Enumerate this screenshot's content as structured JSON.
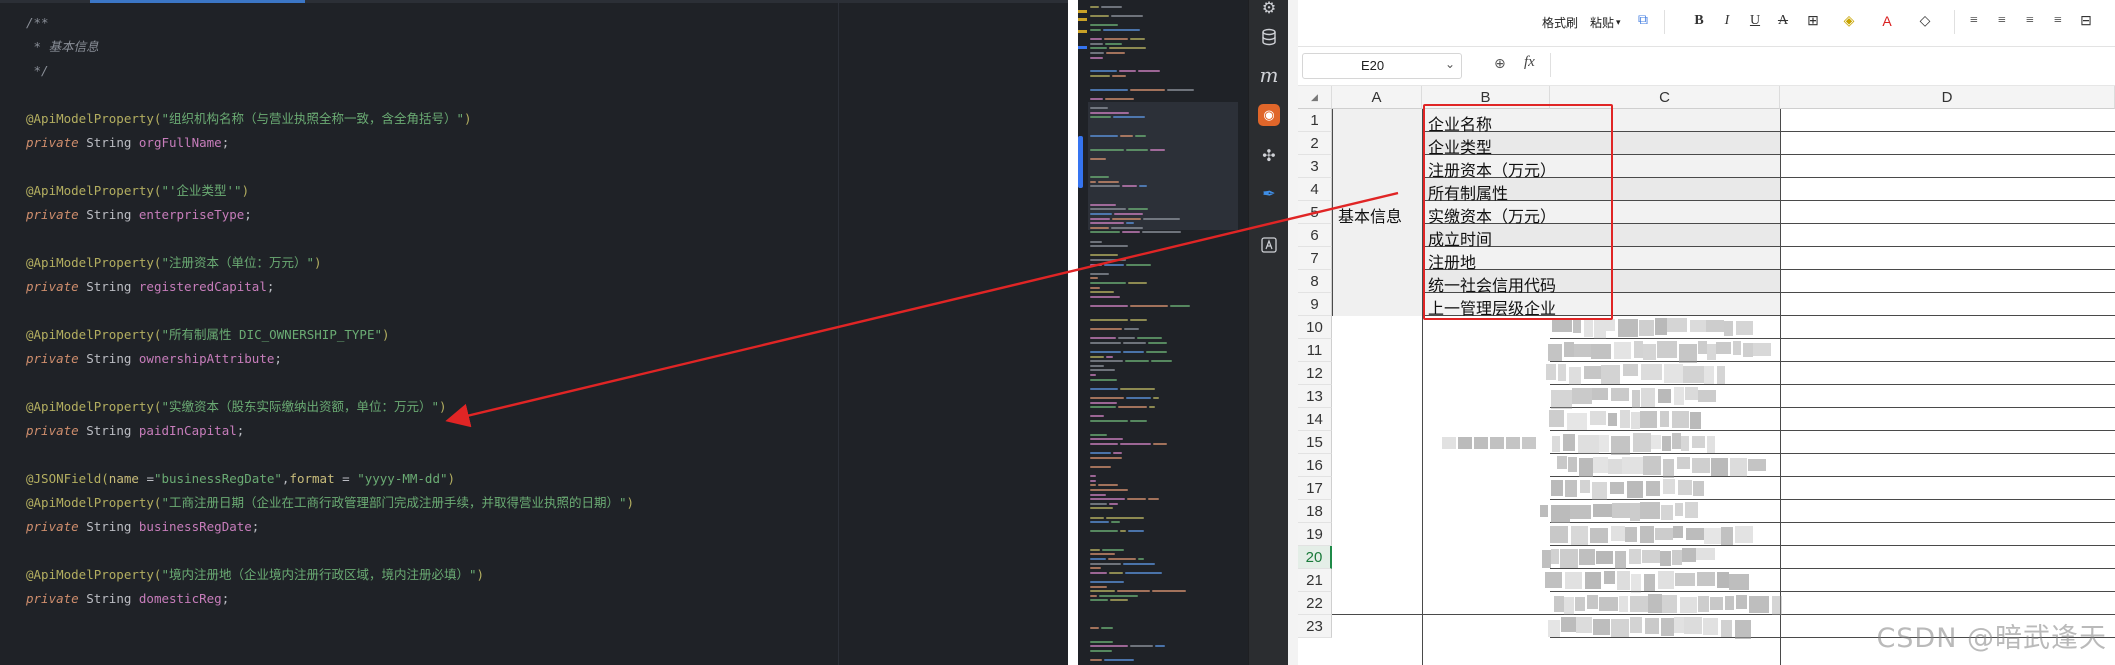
{
  "editor": {
    "lines": [
      {
        "kind": "comment",
        "text": "/**"
      },
      {
        "kind": "comment",
        "text": " * 基本信息"
      },
      {
        "kind": "comment",
        "text": " */"
      },
      {
        "kind": "blank",
        "text": ""
      },
      {
        "kind": "ann",
        "name": "@ApiModelProperty(",
        "str": "\"组织机构名称（与营业执照全称一致，含全角括号）\"",
        "close": ")"
      },
      {
        "kind": "field",
        "kw": "private",
        "type": " String ",
        "name": "orgFullName",
        "end": ";"
      },
      {
        "kind": "blank",
        "text": ""
      },
      {
        "kind": "ann",
        "name": "@ApiModelProperty(",
        "str": "\"'企业类型'\"",
        "close": ")"
      },
      {
        "kind": "field",
        "kw": "private",
        "type": " String ",
        "name": "enterpriseType",
        "end": ";"
      },
      {
        "kind": "blank",
        "text": ""
      },
      {
        "kind": "ann",
        "name": "@ApiModelProperty(",
        "str": "\"注册资本（单位：万元）\"",
        "close": ")"
      },
      {
        "kind": "field",
        "kw": "private",
        "type": " String ",
        "name": "registeredCapital",
        "end": ";"
      },
      {
        "kind": "blank",
        "text": ""
      },
      {
        "kind": "ann",
        "name": "@ApiModelProperty(",
        "str": "\"所有制属性 DIC_OWNERSHIP_TYPE\"",
        "close": ")"
      },
      {
        "kind": "field",
        "kw": "private",
        "type": " String ",
        "name": "ownershipAttribute",
        "end": ";"
      },
      {
        "kind": "blank",
        "text": ""
      },
      {
        "kind": "ann",
        "name": "@ApiModelProperty(",
        "str": "\"实缴资本（股东实际缴纳出资额，单位：万元）\"",
        "close": ")"
      },
      {
        "kind": "field",
        "kw": "private",
        "type": " String ",
        "name": "paidInCapital",
        "end": ";"
      },
      {
        "kind": "blank",
        "text": ""
      },
      {
        "kind": "json",
        "name": "@JSONField(",
        "a1": "name ",
        "eq1": "=",
        "s1": "\"businessRegDate\"",
        "comma": ",",
        "a2": "format ",
        "eq2": "= ",
        "s2": "\"yyyy-MM-dd\"",
        "close": ")"
      },
      {
        "kind": "ann",
        "name": "@ApiModelProperty(",
        "str": "\"工商注册日期（企业在工商行政管理部门完成注册手续，并取得营业执照的日期）\"",
        "close": ")"
      },
      {
        "kind": "field",
        "kw": "private",
        "type": " String ",
        "name": "businessRegDate",
        "end": ";"
      },
      {
        "kind": "blank",
        "text": ""
      },
      {
        "kind": "ann",
        "name": "@ApiModelProperty(",
        "str": "\"境内注册地（企业境内注册行政区域，境内注册必填）\"",
        "close": ")"
      },
      {
        "kind": "field",
        "kw": "private",
        "type": " String ",
        "name": "domesticReg",
        "end": ";"
      }
    ],
    "tools": [
      "database-icon",
      "m",
      "orange-app-icon",
      "plugin-icon",
      "feather-icon",
      "translate-icon"
    ]
  },
  "sheet": {
    "ribbon": {
      "format_painter": "格式刷",
      "paste": "粘贴",
      "bold": "B",
      "italic": "I",
      "underline": "U",
      "strike": "A"
    },
    "namebox": "E20",
    "fx": "fx",
    "columns": [
      "A",
      "B",
      "C",
      "D"
    ],
    "rows": [
      "1",
      "2",
      "3",
      "4",
      "5",
      "6",
      "7",
      "8",
      "9",
      "10",
      "11",
      "12",
      "13",
      "14",
      "15",
      "16",
      "17",
      "18",
      "19",
      "20",
      "21",
      "22",
      "23"
    ],
    "group_label": "基本信息",
    "items": [
      "企业名称",
      "企业类型",
      "注册资本（万元）",
      "所有制属性",
      "实缴资本（万元）",
      "成立时间",
      "注册地",
      "统一社会信用代码",
      "上一管理层级企业"
    ],
    "selected_row": "20",
    "watermark": "CSDN @暗武逢天"
  },
  "colors": {
    "editor_bg": "#1f2227",
    "annotation": "#b3ae60",
    "string": "#6aab73",
    "keyword": "#cf8e6d",
    "field": "#c77dbb",
    "highlight_red": "#e02525",
    "selected_green": "#1f8a48"
  }
}
